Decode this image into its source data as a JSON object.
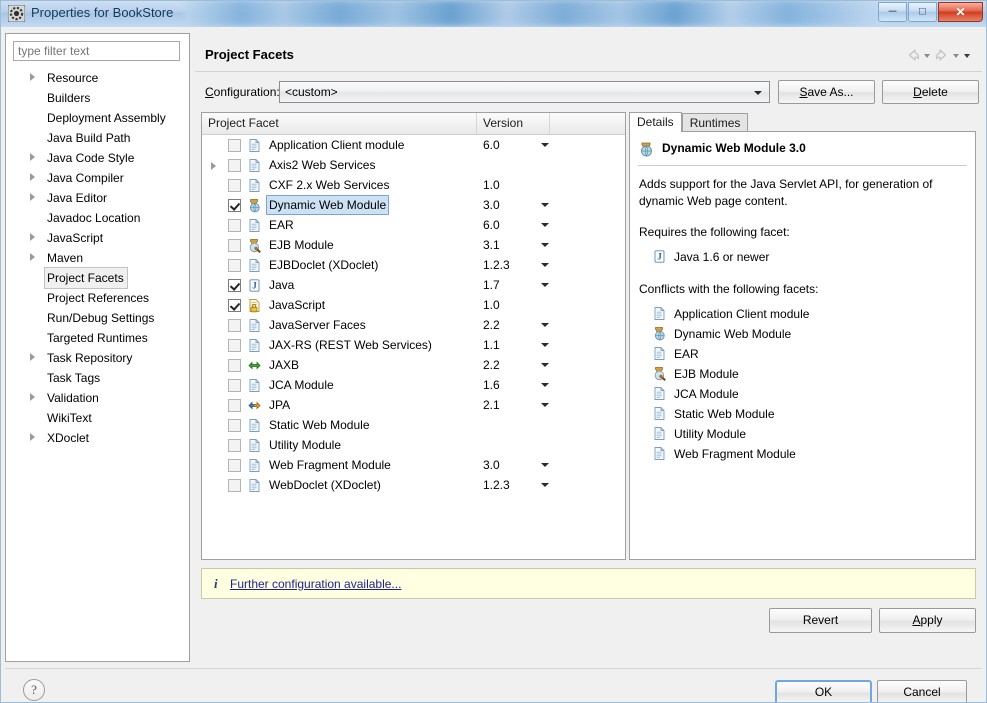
{
  "window": {
    "title": "Properties for BookStore",
    "icon": "eclipse-properties-icon",
    "minimize_label": "─",
    "maximize_label": "□",
    "close_label": "✕"
  },
  "sidebar": {
    "filter_placeholder": "type filter text",
    "filter_value": "",
    "items": [
      {
        "label": "Resource",
        "expandable": true,
        "selected": false
      },
      {
        "label": "Builders",
        "expandable": false,
        "selected": false
      },
      {
        "label": "Deployment Assembly",
        "expandable": false,
        "selected": false
      },
      {
        "label": "Java Build Path",
        "expandable": false,
        "selected": false
      },
      {
        "label": "Java Code Style",
        "expandable": true,
        "selected": false
      },
      {
        "label": "Java Compiler",
        "expandable": true,
        "selected": false
      },
      {
        "label": "Java Editor",
        "expandable": true,
        "selected": false
      },
      {
        "label": "Javadoc Location",
        "expandable": false,
        "selected": false
      },
      {
        "label": "JavaScript",
        "expandable": true,
        "selected": false
      },
      {
        "label": "Maven",
        "expandable": true,
        "selected": false
      },
      {
        "label": "Project Facets",
        "expandable": false,
        "selected": true
      },
      {
        "label": "Project References",
        "expandable": false,
        "selected": false
      },
      {
        "label": "Run/Debug Settings",
        "expandable": false,
        "selected": false
      },
      {
        "label": "Targeted Runtimes",
        "expandable": false,
        "selected": false
      },
      {
        "label": "Task Repository",
        "expandable": true,
        "selected": false
      },
      {
        "label": "Task Tags",
        "expandable": false,
        "selected": false
      },
      {
        "label": "Validation",
        "expandable": true,
        "selected": false
      },
      {
        "label": "WikiText",
        "expandable": false,
        "selected": false
      },
      {
        "label": "XDoclet",
        "expandable": true,
        "selected": false
      }
    ]
  },
  "page": {
    "title": "Project Facets",
    "nav": {
      "back_icon": "back-arrow-icon",
      "forward_icon": "forward-arrow-icon",
      "menu_icon": "view-menu-icon"
    }
  },
  "configuration": {
    "label": "Configuration:",
    "label_mnemonic": "C",
    "value": "<custom>",
    "save_as_label": "Save As...",
    "save_as_mnemonic": "S",
    "delete_label": "Delete",
    "delete_mnemonic": "D"
  },
  "facet_table": {
    "columns": [
      "Project Facet",
      "Version",
      ""
    ],
    "rows": [
      {
        "name": "Application Client module",
        "version": "6.0",
        "checked": false,
        "expandable": false,
        "has_version_dropdown": true,
        "icon": "facet-file-icon",
        "selected": false
      },
      {
        "name": "Axis2 Web Services",
        "version": "",
        "checked": false,
        "expandable": true,
        "has_version_dropdown": false,
        "icon": "facet-file-icon",
        "selected": false
      },
      {
        "name": "CXF 2.x Web Services",
        "version": "1.0",
        "checked": false,
        "expandable": false,
        "has_version_dropdown": false,
        "icon": "facet-file-icon",
        "selected": false
      },
      {
        "name": "Dynamic Web Module",
        "version": "3.0",
        "checked": true,
        "expandable": false,
        "has_version_dropdown": true,
        "icon": "facet-web-icon",
        "selected": true
      },
      {
        "name": "EAR",
        "version": "6.0",
        "checked": false,
        "expandable": false,
        "has_version_dropdown": true,
        "icon": "facet-file-icon",
        "selected": false
      },
      {
        "name": "EJB Module",
        "version": "3.1",
        "checked": false,
        "expandable": false,
        "has_version_dropdown": true,
        "icon": "facet-ejb-icon",
        "selected": false
      },
      {
        "name": "EJBDoclet (XDoclet)",
        "version": "1.2.3",
        "checked": false,
        "expandable": false,
        "has_version_dropdown": true,
        "icon": "facet-file-icon",
        "selected": false
      },
      {
        "name": "Java",
        "version": "1.7",
        "checked": true,
        "expandable": false,
        "has_version_dropdown": true,
        "icon": "facet-java-icon",
        "selected": false
      },
      {
        "name": "JavaScript",
        "version": "1.0",
        "checked": true,
        "expandable": false,
        "has_version_dropdown": false,
        "icon": "facet-js-icon",
        "selected": false
      },
      {
        "name": "JavaServer Faces",
        "version": "2.2",
        "checked": false,
        "expandable": false,
        "has_version_dropdown": true,
        "icon": "facet-file-icon",
        "selected": false
      },
      {
        "name": "JAX-RS (REST Web Services)",
        "version": "1.1",
        "checked": false,
        "expandable": false,
        "has_version_dropdown": true,
        "icon": "facet-file-icon",
        "selected": false
      },
      {
        "name": "JAXB",
        "version": "2.2",
        "checked": false,
        "expandable": false,
        "has_version_dropdown": true,
        "icon": "facet-jaxb-icon",
        "selected": false
      },
      {
        "name": "JCA Module",
        "version": "1.6",
        "checked": false,
        "expandable": false,
        "has_version_dropdown": true,
        "icon": "facet-file-icon",
        "selected": false
      },
      {
        "name": "JPA",
        "version": "2.1",
        "checked": false,
        "expandable": false,
        "has_version_dropdown": true,
        "icon": "facet-jpa-icon",
        "selected": false
      },
      {
        "name": "Static Web Module",
        "version": "",
        "checked": false,
        "expandable": false,
        "has_version_dropdown": false,
        "icon": "facet-file-icon",
        "selected": false
      },
      {
        "name": "Utility Module",
        "version": "",
        "checked": false,
        "expandable": false,
        "has_version_dropdown": false,
        "icon": "facet-file-icon",
        "selected": false
      },
      {
        "name": "Web Fragment Module",
        "version": "3.0",
        "checked": false,
        "expandable": false,
        "has_version_dropdown": true,
        "icon": "facet-file-icon",
        "selected": false
      },
      {
        "name": "WebDoclet (XDoclet)",
        "version": "1.2.3",
        "checked": false,
        "expandable": false,
        "has_version_dropdown": true,
        "icon": "facet-file-icon",
        "selected": false
      }
    ]
  },
  "details": {
    "tabs": [
      {
        "label": "Details",
        "mnemonic": "t",
        "active": true
      },
      {
        "label": "Runtimes",
        "mnemonic": "R",
        "active": false
      }
    ],
    "heading": "Dynamic Web Module 3.0",
    "heading_icon": "facet-web-icon",
    "description": "Adds support for the Java Servlet API, for generation of dynamic Web page content.",
    "requires_label": "Requires the following facet:",
    "requires": [
      {
        "label": "Java 1.6 or newer",
        "icon": "facet-java-icon"
      }
    ],
    "conflicts_label": "Conflicts with the following facets:",
    "conflicts": [
      {
        "label": "Application Client module",
        "icon": "facet-file-icon"
      },
      {
        "label": "Dynamic Web Module",
        "icon": "facet-web-icon"
      },
      {
        "label": "EAR",
        "icon": "facet-file-icon"
      },
      {
        "label": "EJB Module",
        "icon": "facet-ejb-icon"
      },
      {
        "label": "JCA Module",
        "icon": "facet-file-icon"
      },
      {
        "label": "Static Web Module",
        "icon": "facet-file-icon"
      },
      {
        "label": "Utility Module",
        "icon": "facet-file-icon"
      },
      {
        "label": "Web Fragment Module",
        "icon": "facet-file-icon"
      }
    ]
  },
  "info_bar": {
    "icon": "info-icon",
    "link_text": "Further configuration available..."
  },
  "page_buttons": {
    "revert_label": "Revert",
    "apply_label": "Apply",
    "apply_mnemonic": "A"
  },
  "footer": {
    "help_label": "?",
    "ok_label": "OK",
    "cancel_label": "Cancel"
  },
  "colors": {
    "selection_blue": "#cde1f5",
    "info_bg": "#ffffe1",
    "link": "#1f1f8f",
    "title_text": "#14395c"
  }
}
